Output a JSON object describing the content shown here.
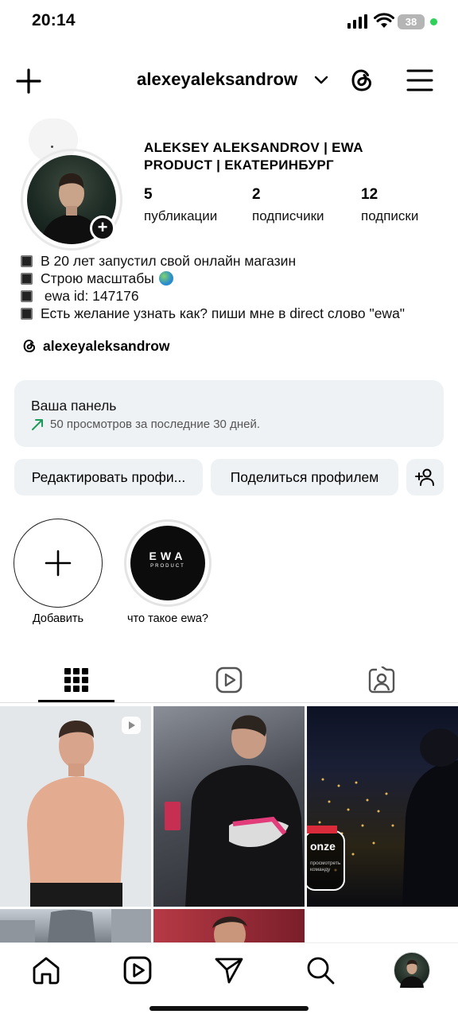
{
  "status_bar": {
    "time": "20:14",
    "battery": "38"
  },
  "header": {
    "username": "alexeyaleksandrow"
  },
  "profile": {
    "full_name": "ALEKSEY ALEKSANDROV | EWA PRODUCT | ЕКАТЕРИНБУРГ",
    "stats": [
      {
        "value": "5",
        "label": "публикации"
      },
      {
        "value": "2",
        "label": "подписчики"
      },
      {
        "value": "12",
        "label": "подписки"
      }
    ],
    "bio": [
      "В 20 лет запустил свой онлайн магазин",
      "Строю масштабы",
      " ewa id: 147176",
      "Есть желание узнать как? пиши мне в direct слово \"ewa\""
    ],
    "threads_handle": "alexeyaleksandrow"
  },
  "dashboard": {
    "title": "Ваша панель",
    "subtitle": "50 просмотров за последние 30 дней."
  },
  "buttons": {
    "edit": "Редактировать профи...",
    "share": "Поделиться профилем"
  },
  "highlights": [
    {
      "label": "Добавить"
    },
    {
      "label": "что такое ewa?",
      "cover_text": "EWA",
      "cover_sub": "PRODUCT"
    }
  ],
  "tabs": [
    {
      "icon": "grid-icon",
      "active": true
    },
    {
      "icon": "reels-icon",
      "active": false
    },
    {
      "icon": "tagged-icon",
      "active": false
    }
  ],
  "posts": {
    "p3_badge": "onze",
    "p3_caption": "просмотреть команду"
  },
  "colors": {
    "accent_green": "#2fd158",
    "panel_bg": "#eff2f5",
    "trend_arrow": "#1e9a5a"
  }
}
